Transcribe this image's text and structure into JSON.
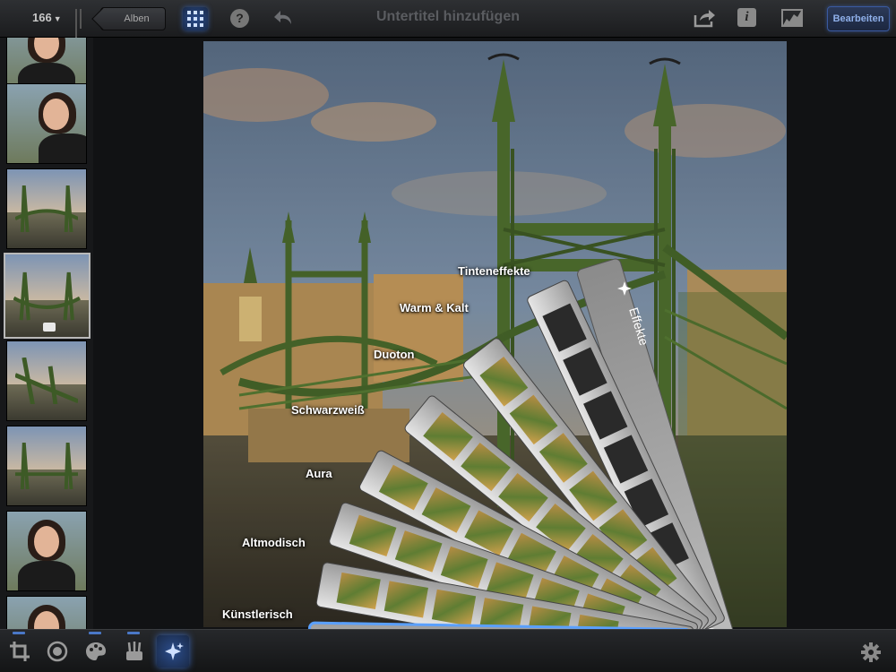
{
  "topbar": {
    "photo_count": "166",
    "albums_label": "Alben",
    "title": "Untertitel hinzufügen",
    "edit_label": "Bearbeiten",
    "help_glyph": "?",
    "info_glyph": "i"
  },
  "sidebar": {
    "thumbnails": [
      {
        "kind": "portrait",
        "selected": false
      },
      {
        "kind": "portrait",
        "selected": false
      },
      {
        "kind": "bridge",
        "selected": false
      },
      {
        "kind": "bridge",
        "selected": true
      },
      {
        "kind": "bridge",
        "selected": false
      },
      {
        "kind": "bridge",
        "selected": false
      },
      {
        "kind": "portrait",
        "selected": false
      },
      {
        "kind": "portrait",
        "selected": false
      }
    ]
  },
  "effects_fan": {
    "header_label": "Effekte",
    "categories": [
      {
        "label": "Tinteneffekte"
      },
      {
        "label": "Warm & Kalt"
      },
      {
        "label": "Duoton"
      },
      {
        "label": "Schwarzweiß"
      },
      {
        "label": "Aura"
      },
      {
        "label": "Altmodisch"
      },
      {
        "label": "Künstlerisch"
      }
    ]
  },
  "bottombar": {
    "tools": [
      "crop-icon",
      "exposure-icon",
      "color-palette-icon",
      "brushes-icon",
      "effects-icon"
    ],
    "active_tool": "effects-icon"
  },
  "colors": {
    "accent": "#4a78c7",
    "bridge_green": "#4d6b2e",
    "toolbar_dark": "#1b1c1e"
  }
}
